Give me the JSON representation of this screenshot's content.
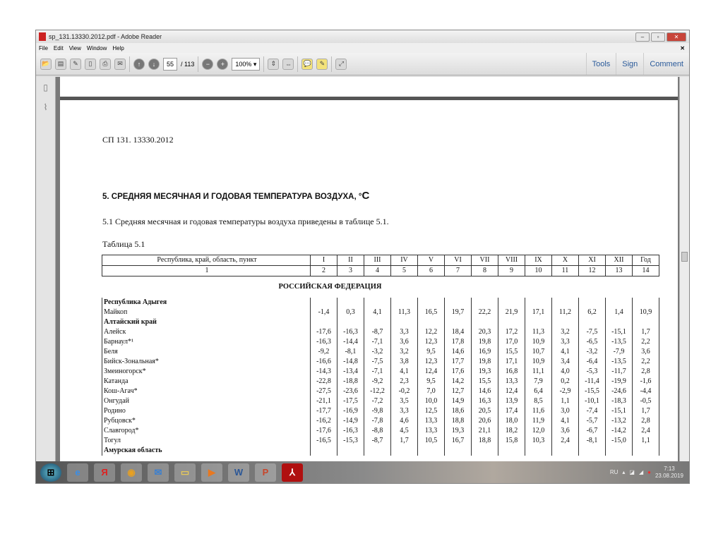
{
  "window": {
    "title": "sp_131.13330.2012.pdf - Adobe Reader"
  },
  "menu": [
    "File",
    "Edit",
    "View",
    "Window",
    "Help"
  ],
  "toolbar": {
    "page_current": "55",
    "page_total": "/ 113",
    "zoom": "100%",
    "tools": "Tools",
    "sign": "Sign",
    "comment": "Comment"
  },
  "doc": {
    "code": "СП 131. 13330.2012",
    "heading": "5. СРЕДНЯЯ МЕСЯЧНАЯ И ГОДОВАЯ ТЕМПЕРАТУРА ВОЗДУХА, °",
    "heading_unit": "С",
    "paragraph": "5.1 Средняя месячная и годовая температуры воздуха приведены в таблице 5.1.",
    "table_caption": "Таблица 5.1",
    "headers": [
      "Республика, край, область, пункт",
      "I",
      "II",
      "III",
      "IV",
      "V",
      "VI",
      "VII",
      "VIII",
      "IX",
      "X",
      "XI",
      "XII",
      "Год"
    ],
    "col_numbers": [
      "1",
      "2",
      "3",
      "4",
      "5",
      "6",
      "7",
      "8",
      "9",
      "10",
      "11",
      "12",
      "13",
      "14"
    ],
    "section": "РОССИЙСКАЯ ФЕДЕРАЦИЯ",
    "rows": [
      {
        "name": "Республика Адыгея",
        "region": true,
        "values": []
      },
      {
        "name": "Майкоп",
        "values": [
          "-1,4",
          "0,3",
          "4,1",
          "11,3",
          "16,5",
          "19,7",
          "22,2",
          "21,9",
          "17,1",
          "11,2",
          "6,2",
          "1,4",
          "10,9"
        ]
      },
      {
        "name": "Алтайский край",
        "region": true,
        "values": []
      },
      {
        "name": "Алейск",
        "values": [
          "-17,6",
          "-16,3",
          "-8,7",
          "3,3",
          "12,2",
          "18,4",
          "20,3",
          "17,2",
          "11,3",
          "3,2",
          "-7,5",
          "-15,1",
          "1,7"
        ]
      },
      {
        "name": "Барнаул*¹",
        "values": [
          "-16,3",
          "-14,4",
          "-7,1",
          "3,6",
          "12,3",
          "17,8",
          "19,8",
          "17,0",
          "10,9",
          "3,3",
          "-6,5",
          "-13,5",
          "2,2"
        ]
      },
      {
        "name": "Беля",
        "values": [
          "-9,2",
          "-8,1",
          "-3,2",
          "3,2",
          "9,5",
          "14,6",
          "16,9",
          "15,5",
          "10,7",
          "4,1",
          "-3,2",
          "-7,9",
          "3,6"
        ]
      },
      {
        "name": "Бийск-Зональная*",
        "values": [
          "-16,6",
          "-14,8",
          "-7,5",
          "3,8",
          "12,3",
          "17,7",
          "19,8",
          "17,1",
          "10,9",
          "3,4",
          "-6,4",
          "-13,5",
          "2,2"
        ]
      },
      {
        "name": "Змеиногорск*",
        "values": [
          "-14,3",
          "-13,4",
          "-7,1",
          "4,1",
          "12,4",
          "17,6",
          "19,3",
          "16,8",
          "11,1",
          "4,0",
          "-5,3",
          "-11,7",
          "2,8"
        ]
      },
      {
        "name": "Катанда",
        "values": [
          "-22,8",
          "-18,8",
          "-9,2",
          "2,3",
          "9,5",
          "14,2",
          "15,5",
          "13,3",
          "7,9",
          "0,2",
          "-11,4",
          "-19,9",
          "-1,6"
        ]
      },
      {
        "name": "Кош-Агач*",
        "values": [
          "-27,5",
          "-23,6",
          "-12,2",
          "-0,2",
          "7,0",
          "12,7",
          "14,6",
          "12,4",
          "6,4",
          "-2,9",
          "-15,5",
          "-24,6",
          "-4,4"
        ]
      },
      {
        "name": "Онгудай",
        "values": [
          "-21,1",
          "-17,5",
          "-7,2",
          "3,5",
          "10,0",
          "14,9",
          "16,3",
          "13,9",
          "8,5",
          "1,1",
          "-10,1",
          "-18,3",
          "-0,5"
        ]
      },
      {
        "name": "Родино",
        "values": [
          "-17,7",
          "-16,9",
          "-9,8",
          "3,3",
          "12,5",
          "18,6",
          "20,5",
          "17,4",
          "11,6",
          "3,0",
          "-7,4",
          "-15,1",
          "1,7"
        ]
      },
      {
        "name": "Рубцовск*",
        "values": [
          "-16,2",
          "-14,9",
          "-7,8",
          "4,6",
          "13,3",
          "18,8",
          "20,6",
          "18,0",
          "11,9",
          "4,1",
          "-5,7",
          "-13,2",
          "2,8"
        ]
      },
      {
        "name": "Славгород*",
        "values": [
          "-17,6",
          "-16,3",
          "-8,8",
          "4,5",
          "13,3",
          "19,3",
          "21,1",
          "18,2",
          "12,0",
          "3,6",
          "-6,7",
          "-14,2",
          "2,4"
        ]
      },
      {
        "name": "Тогул",
        "values": [
          "-16,5",
          "-15,3",
          "-8,7",
          "1,7",
          "10,5",
          "16,7",
          "18,8",
          "15,8",
          "10,3",
          "2,4",
          "-8,1",
          "-15,0",
          "1,1"
        ]
      },
      {
        "name": "Амурская область",
        "region": true,
        "values": []
      }
    ]
  },
  "tray": {
    "lang": "RU",
    "time": "7:13",
    "date": "23.08.2019"
  }
}
